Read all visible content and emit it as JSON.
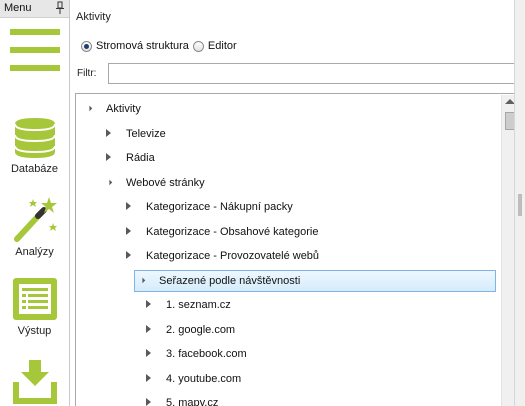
{
  "sidebar": {
    "menu_title": "Menu",
    "items": [
      {
        "label": "Databáze",
        "icon": "database-icon"
      },
      {
        "label": "Analýzy",
        "icon": "magic-wand-icon"
      },
      {
        "label": "Výstup",
        "icon": "output-list-icon"
      },
      {
        "label": "",
        "icon": "import-download-icon"
      }
    ]
  },
  "panel": {
    "title": "Aktivity",
    "view_mode": {
      "options": [
        "Stromová struktura",
        "Editor"
      ],
      "selected": "Stromová struktura"
    },
    "filter": {
      "label": "Filtr:",
      "value": ""
    }
  },
  "tree": {
    "rows": [
      {
        "text": "Aktivity",
        "level": 0,
        "expanded": true,
        "selected": false
      },
      {
        "text": "Televize",
        "level": 1,
        "expanded": false,
        "selected": false
      },
      {
        "text": "Rádia",
        "level": 1,
        "expanded": false,
        "selected": false
      },
      {
        "text": "Webové stránky",
        "level": 1,
        "expanded": true,
        "selected": false
      },
      {
        "text": "Kategorizace - Nákupní packy",
        "level": 2,
        "expanded": false,
        "selected": false
      },
      {
        "text": "Kategorizace - Obsahové kategorie",
        "level": 2,
        "expanded": false,
        "selected": false
      },
      {
        "text": "Kategorizace - Provozovatelé webů",
        "level": 2,
        "expanded": false,
        "selected": false
      },
      {
        "text": "Seřazené podle návštěvnosti",
        "level": 2,
        "expanded": true,
        "selected": true
      },
      {
        "text": "1. seznam.cz",
        "level": 3,
        "expanded": false,
        "selected": false
      },
      {
        "text": "2. google.com",
        "level": 3,
        "expanded": false,
        "selected": false
      },
      {
        "text": "3. facebook.com",
        "level": 3,
        "expanded": false,
        "selected": false
      },
      {
        "text": "4. youtube.com",
        "level": 3,
        "expanded": false,
        "selected": false
      },
      {
        "text": "5. mapy.cz",
        "level": 3,
        "expanded": false,
        "selected": false
      }
    ]
  },
  "colors": {
    "accent_green": "#a6c73a",
    "selection_border": "#7eb4ea",
    "selection_fill": "#d5ecfb"
  }
}
